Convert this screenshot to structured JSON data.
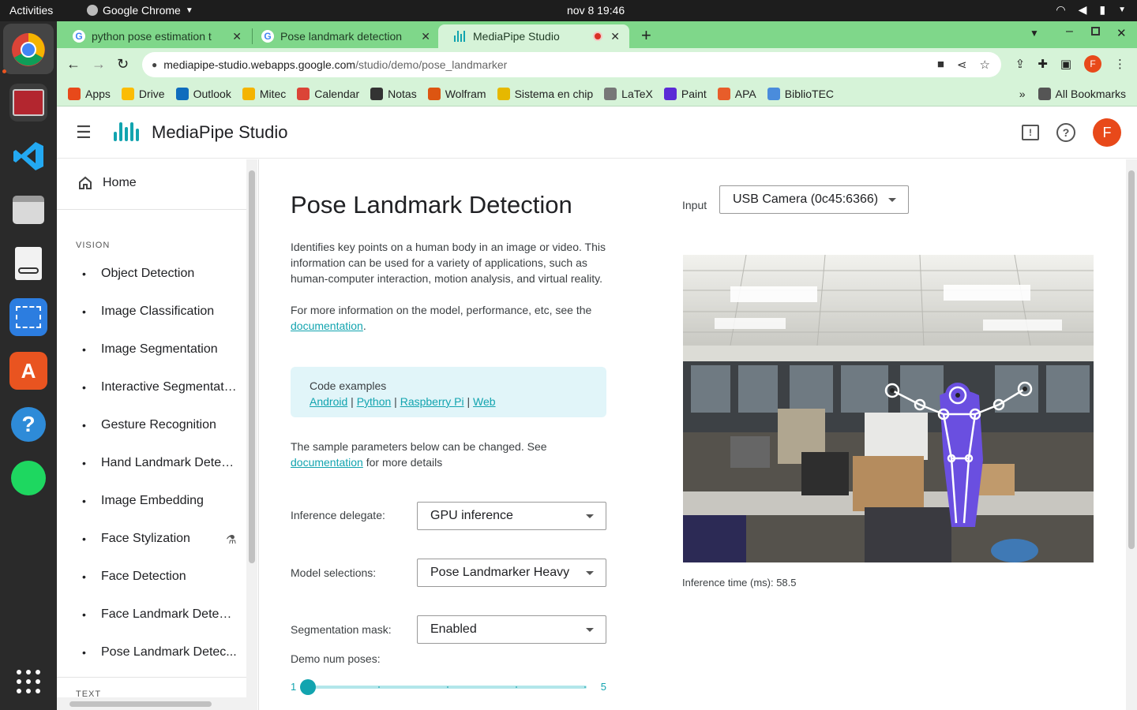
{
  "os": {
    "activities": "Activities",
    "app_name": "Google Chrome",
    "clock": "nov 8  19:46"
  },
  "tabs": [
    {
      "label": "python pose estimation t"
    },
    {
      "label": "Pose landmark detection"
    },
    {
      "label": "MediaPipe Studio"
    }
  ],
  "address": {
    "host": "mediapipe-studio.webapps.google.com",
    "path": "/studio/demo/pose_landmarker"
  },
  "profile_initial": "F",
  "bookmarks": [
    {
      "label": "Apps",
      "color": "#e8491a"
    },
    {
      "label": "Drive",
      "color": "#fbbc04"
    },
    {
      "label": "Outlook",
      "color": "#0f6cbd"
    },
    {
      "label": "Mitec",
      "color": "#f4b400"
    },
    {
      "label": "Calendar",
      "color": "#db4437"
    },
    {
      "label": "Notas",
      "color": "#333333"
    },
    {
      "label": "Wolfram",
      "color": "#dd5511"
    },
    {
      "label": "Sistema en chip",
      "color": "#e6b800"
    },
    {
      "label": "LaTeX",
      "color": "#777777"
    },
    {
      "label": "Paint",
      "color": "#5b2bd6"
    },
    {
      "label": "APA",
      "color": "#e85d2a"
    },
    {
      "label": "BiblioTEC",
      "color": "#4a8cdc"
    }
  ],
  "all_bookmarks": "All Bookmarks",
  "app": {
    "title": "MediaPipe Studio"
  },
  "sidebar": {
    "home": "Home",
    "section_vision": "VISION",
    "section_text": "TEXT",
    "items": [
      {
        "label": "Object Detection"
      },
      {
        "label": "Image Classification"
      },
      {
        "label": "Image Segmentation"
      },
      {
        "label": "Interactive Segmentati..."
      },
      {
        "label": "Gesture Recognition"
      },
      {
        "label": "Hand Landmark Detec..."
      },
      {
        "label": "Image Embedding"
      },
      {
        "label": "Face Stylization"
      },
      {
        "label": "Face Detection"
      },
      {
        "label": "Face Landmark Detect..."
      },
      {
        "label": "Pose Landmark Detec..."
      }
    ]
  },
  "main": {
    "title": "Pose Landmark Detection",
    "desc1": "Identifies key points on a human body in an image or video. This information can be used for a variety of applications, such as human-computer interaction, motion analysis, and virtual reality.",
    "desc2_prefix": "For more information on the model, performance, etc, see the ",
    "desc2_link": "documentation",
    "desc2_suffix": ".",
    "code_title": "Code examples",
    "code_links": [
      "Android",
      "Python",
      "Raspberry Pi",
      "Web"
    ],
    "params_note_prefix": "The sample parameters below can be changed. See ",
    "params_note_link": "documentation",
    "params_note_suffix": " for more details",
    "delegate_label": "Inference delegate:",
    "delegate_value": "GPU inference",
    "model_label": "Model selections:",
    "model_value": "Pose Landmarker Heavy",
    "seg_label": "Segmentation mask:",
    "seg_value": "Enabled",
    "poses_label": "Demo num poses:",
    "poses_min": "1",
    "poses_max": "5",
    "poses_value": 1,
    "input_label": "Input",
    "input_value": "USB Camera (0c45:6366)",
    "inference_time": "Inference time (ms): 58.5"
  }
}
